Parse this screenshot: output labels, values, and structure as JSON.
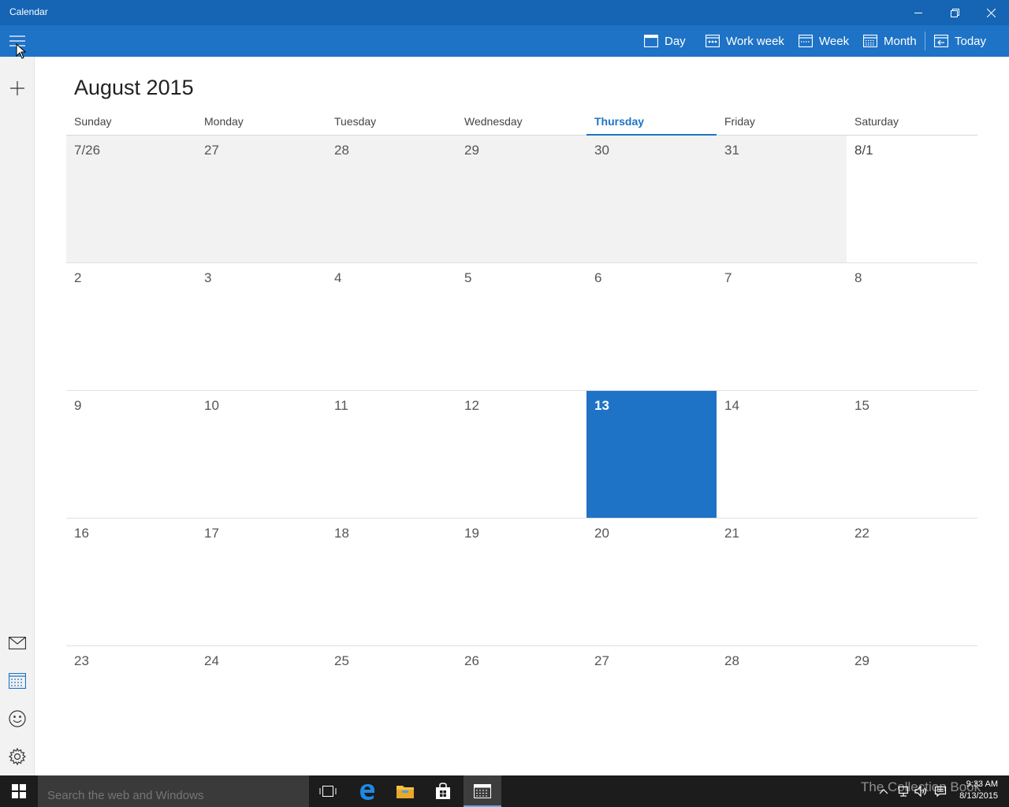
{
  "window": {
    "title": "Calendar"
  },
  "toolbar": {
    "day_label": "Day",
    "workweek_label": "Work week",
    "week_label": "Week",
    "month_label": "Month",
    "today_label": "Today"
  },
  "calendar": {
    "month_title": "August 2015",
    "weekdays": [
      "Sunday",
      "Monday",
      "Tuesday",
      "Wednesday",
      "Thursday",
      "Friday",
      "Saturday"
    ],
    "today_weekday": "Thursday",
    "weeks": [
      [
        "7/26",
        "27",
        "28",
        "29",
        "30",
        "31",
        "8/1"
      ],
      [
        "2",
        "3",
        "4",
        "5",
        "6",
        "7",
        "8"
      ],
      [
        "9",
        "10",
        "11",
        "12",
        "13",
        "14",
        "15"
      ],
      [
        "16",
        "17",
        "18",
        "19",
        "20",
        "21",
        "22"
      ],
      [
        "23",
        "24",
        "25",
        "26",
        "27",
        "28",
        "29"
      ]
    ],
    "today": "13"
  },
  "taskbar": {
    "search_placeholder": "Search the web and Windows",
    "watermark": "The Collection Book",
    "clock_time": "9:33 AM",
    "clock_date": "8/13/2015"
  },
  "colors": {
    "titlebar": "#1565b4",
    "toolbar": "#1e73c6",
    "accent": "#1e73c6",
    "taskbar": "#1c1c1c"
  },
  "icons": {
    "titlebar": [
      "minimize-icon",
      "restore-icon",
      "close-icon"
    ],
    "toolbar": [
      "hamburger-icon",
      "day-view-icon",
      "workweek-view-icon",
      "week-view-icon",
      "month-view-icon",
      "today-icon"
    ],
    "rail": [
      "add-icon",
      "mail-icon",
      "calendar-icon",
      "smiley-icon",
      "gear-icon"
    ],
    "taskbar": [
      "windows-start-icon",
      "task-view-icon",
      "edge-icon",
      "file-explorer-icon",
      "store-icon",
      "calendar-app-icon",
      "chevron-up-icon",
      "network-icon",
      "volume-icon",
      "action-center-icon"
    ]
  }
}
